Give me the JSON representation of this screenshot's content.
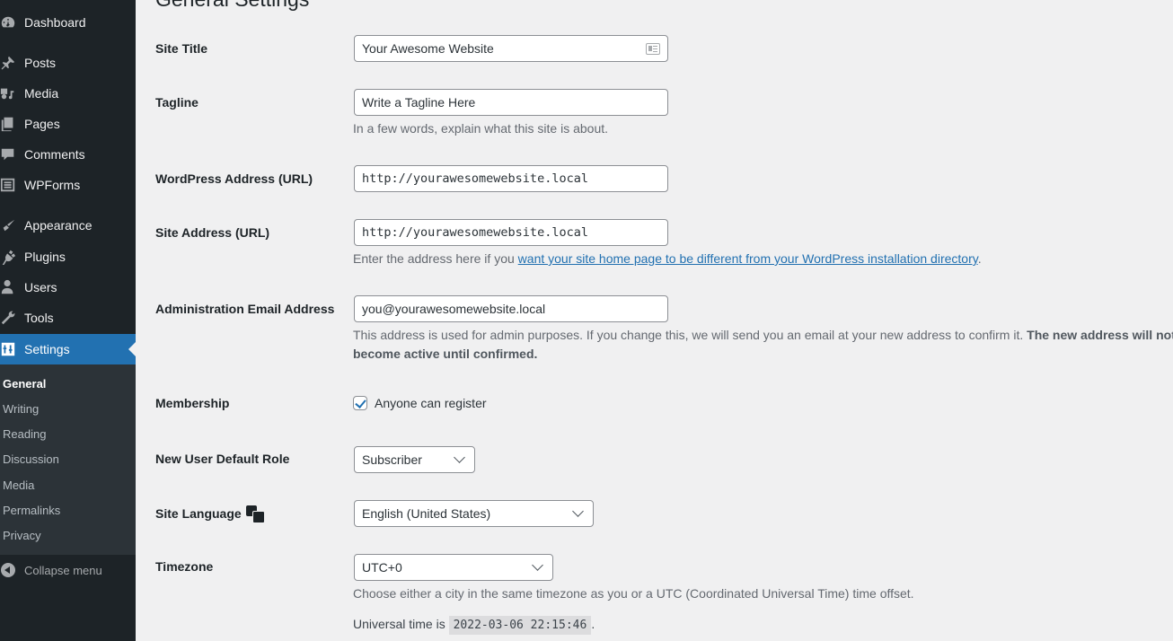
{
  "sidebar": {
    "items": [
      {
        "label": "Dashboard",
        "icon": "dashboard-icon"
      },
      {
        "label": "Posts",
        "icon": "pin-icon"
      },
      {
        "label": "Media",
        "icon": "media-icon"
      },
      {
        "label": "Pages",
        "icon": "pages-icon"
      },
      {
        "label": "Comments",
        "icon": "comment-icon"
      },
      {
        "label": "WPForms",
        "icon": "forms-icon"
      },
      {
        "label": "Appearance",
        "icon": "brush-icon"
      },
      {
        "label": "Plugins",
        "icon": "plug-icon"
      },
      {
        "label": "Users",
        "icon": "user-icon"
      },
      {
        "label": "Tools",
        "icon": "wrench-icon"
      },
      {
        "label": "Settings",
        "icon": "sliders-icon",
        "active": true
      }
    ],
    "submenu": [
      "General",
      "Writing",
      "Reading",
      "Discussion",
      "Media",
      "Permalinks",
      "Privacy"
    ],
    "submenu_current": "General",
    "collapse_label": "Collapse menu",
    "accent_color": "#2271b1"
  },
  "page": {
    "title": "General Settings",
    "site_title": {
      "label": "Site Title",
      "value": "Your Awesome Website"
    },
    "tagline": {
      "label": "Tagline",
      "value": "Write a Tagline Here",
      "description": "In a few words, explain what this site is about."
    },
    "wp_address": {
      "label": "WordPress Address (URL)",
      "value": "http://yourawesomewebsite.local"
    },
    "site_address": {
      "label": "Site Address (URL)",
      "value": "http://yourawesomewebsite.local",
      "description_prefix": "Enter the address here if you ",
      "description_link": "want your site home page to be different from your WordPress installation directory",
      "description_suffix": "."
    },
    "admin_email": {
      "label": "Administration Email Address",
      "value": "you@yourawesomewebsite.local",
      "description": "This address is used for admin purposes. If you change this, we will send you an email at your new address to confirm it. ",
      "description_bold": "The new address will not become active until confirmed."
    },
    "membership": {
      "label": "Membership",
      "checkbox_label": "Anyone can register",
      "checked": true
    },
    "default_role": {
      "label": "New User Default Role",
      "value": "Subscriber"
    },
    "site_language": {
      "label": "Site Language",
      "value": "English (United States)"
    },
    "timezone": {
      "label": "Timezone",
      "value": "UTC+0",
      "description": "Choose either a city in the same timezone as you or a UTC (Coordinated Universal Time) time offset.",
      "universal_prefix": "Universal time is ",
      "universal_time": "2022-03-06 22:15:46",
      "universal_suffix": "."
    }
  }
}
